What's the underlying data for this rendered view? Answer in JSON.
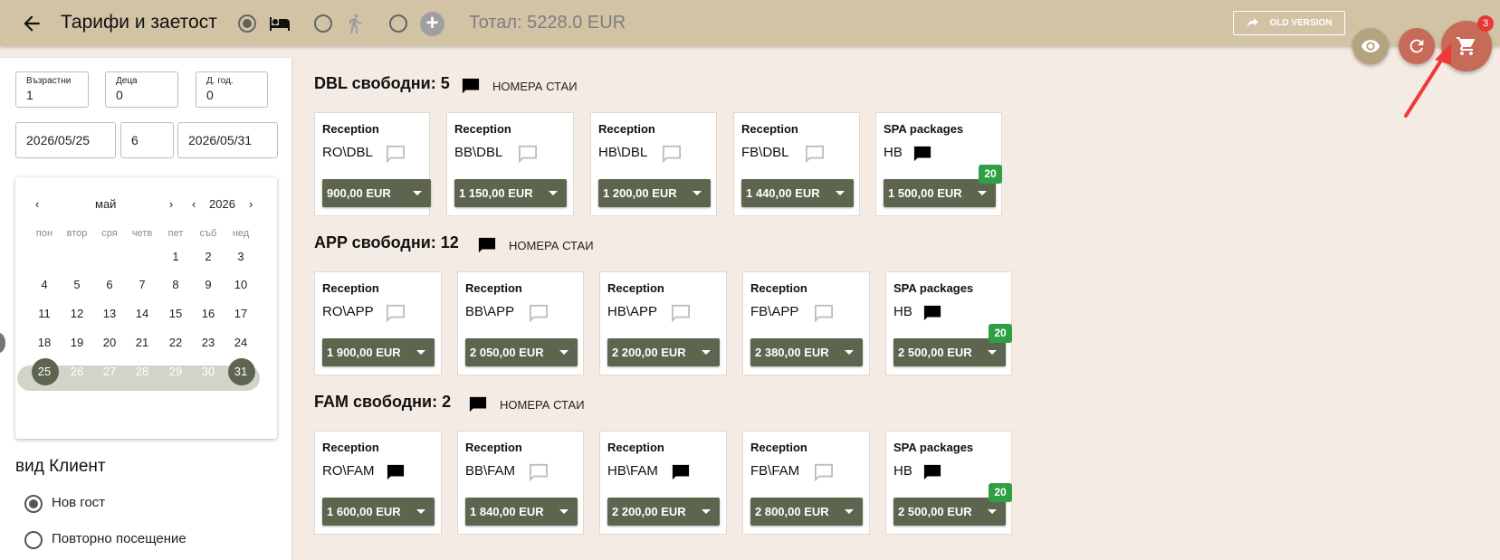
{
  "header": {
    "title": "Тарифи и заетост",
    "total": "Тотал: 5228.0 EUR",
    "old_version": "OLD VERSION",
    "cart_badge": "3"
  },
  "left": {
    "adults_label": "Възрастни",
    "adults_value": "1",
    "children_label": "Деца",
    "children_value": "0",
    "child_age_label": "Д. год.",
    "child_age_value": "0",
    "date_from": "2026/05/25",
    "nights": "6",
    "date_to": "2026/05/31",
    "calendar": {
      "month": "май",
      "year": "2026",
      "weekdays": [
        "пон",
        "втор",
        "сря",
        "четв",
        "пет",
        "съб",
        "нед"
      ],
      "days": [
        "1",
        "2",
        "3",
        "4",
        "5",
        "6",
        "7",
        "8",
        "9",
        "10",
        "11",
        "12",
        "13",
        "14",
        "15",
        "16",
        "17",
        "18",
        "19",
        "20",
        "21",
        "22",
        "23",
        "24",
        "25",
        "26",
        "27",
        "28",
        "29",
        "30",
        "31"
      ],
      "range_start": 25,
      "range_end": 31
    },
    "client_title": "вид Клиент",
    "client_options": [
      "Нов гост",
      "Повторно посещение"
    ],
    "client_selected": "Нов гост"
  },
  "sections": [
    {
      "type": "DBL",
      "heading": "DBL свободни: 5",
      "rooms_link": "НОМЕРА СТАИ",
      "cards": [
        {
          "title": "Reception",
          "code": "RO\\DBL",
          "msg_filled": false,
          "price": "900,00 EUR"
        },
        {
          "title": "Reception",
          "code": "BB\\DBL",
          "msg_filled": false,
          "price": "1 150,00 EUR"
        },
        {
          "title": "Reception",
          "code": "HB\\DBL",
          "msg_filled": false,
          "price": "1 200,00 EUR"
        },
        {
          "title": "Reception",
          "code": "FB\\DBL",
          "msg_filled": false,
          "price": "1 440,00 EUR"
        },
        {
          "title": "SPA packages",
          "code": "HB",
          "msg_filled": true,
          "price": "1 500,00 EUR",
          "badge": "20"
        }
      ]
    },
    {
      "type": "APP",
      "heading": "APP свободни: 12",
      "rooms_link": "НОМЕРА СТАИ",
      "cards": [
        {
          "title": "Reception",
          "code": "RO\\APP",
          "msg_filled": false,
          "price": "1 900,00 EUR"
        },
        {
          "title": "Reception",
          "code": "BB\\APP",
          "msg_filled": false,
          "price": "2 050,00 EUR"
        },
        {
          "title": "Reception",
          "code": "HB\\APP",
          "msg_filled": false,
          "price": "2 200,00 EUR"
        },
        {
          "title": "Reception",
          "code": "FB\\APP",
          "msg_filled": false,
          "price": "2 380,00 EUR"
        },
        {
          "title": "SPA packages",
          "code": "HB",
          "msg_filled": true,
          "price": "2 500,00 EUR",
          "badge": "20"
        }
      ]
    },
    {
      "type": "FAM",
      "heading": "FAM свободни: 2",
      "rooms_link": "НОМЕРА СТАИ",
      "cards": [
        {
          "title": "Reception",
          "code": "RO\\FAM",
          "msg_filled": true,
          "price": "1 600,00 EUR"
        },
        {
          "title": "Reception",
          "code": "BB\\FAM",
          "msg_filled": false,
          "price": "1 840,00 EUR"
        },
        {
          "title": "Reception",
          "code": "HB\\FAM",
          "msg_filled": true,
          "price": "2 200,00 EUR"
        },
        {
          "title": "Reception",
          "code": "FB\\FAM",
          "msg_filled": false,
          "price": "2 800,00 EUR"
        },
        {
          "title": "SPA packages",
          "code": "HB",
          "msg_filled": true,
          "price": "2 500,00 EUR",
          "badge": "20"
        }
      ]
    }
  ],
  "icons": {
    "back": "arrow-left-icon",
    "room": "bed-icon",
    "walk": "walking-person-icon",
    "add": "plus-circle-icon",
    "eye": "eye-icon",
    "refresh": "refresh-icon",
    "cart": "cart-icon",
    "message": "message-icon"
  },
  "colors": {
    "topbar": "#d2c3a5",
    "price_button": "#5e654f",
    "fab_red": "#c76a57",
    "badge_green": "#2ea043",
    "background": "#f4ebe4"
  }
}
